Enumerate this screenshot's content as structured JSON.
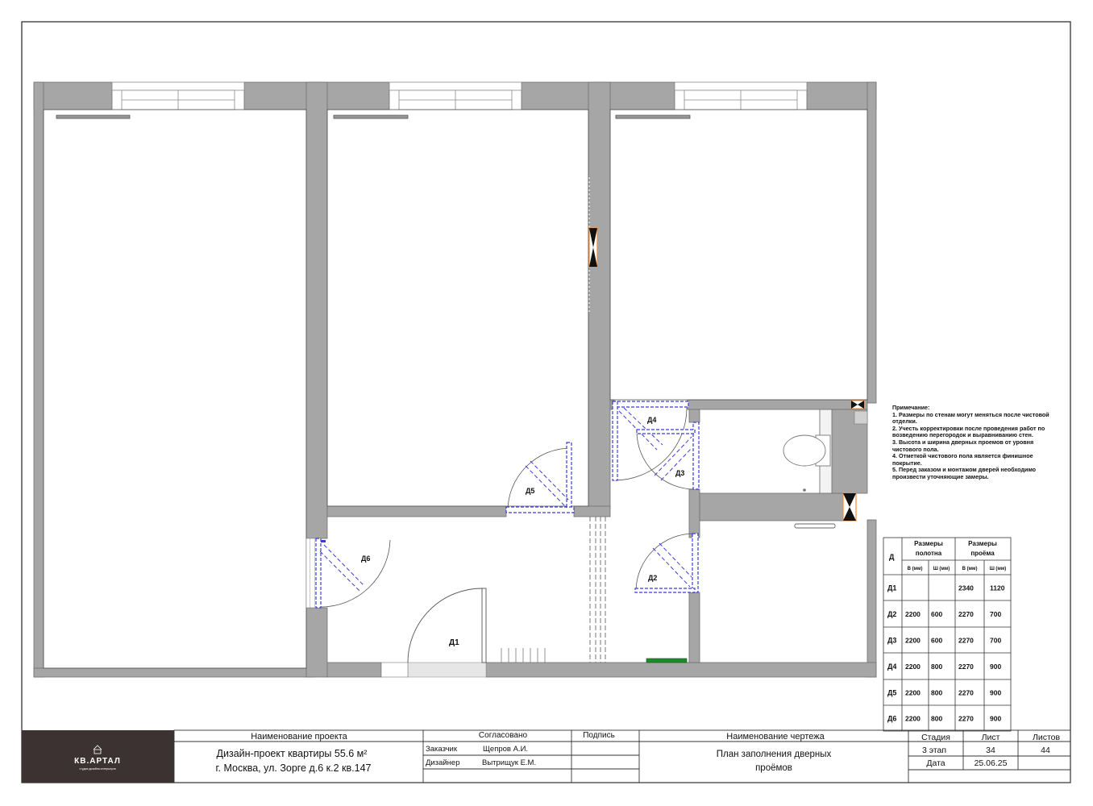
{
  "doors": [
    {
      "id": "Д1",
      "leaf_h": "",
      "leaf_w": "",
      "open_h": "2340",
      "open_w": "1120"
    },
    {
      "id": "Д2",
      "leaf_h": "2200",
      "leaf_w": "600",
      "open_h": "2270",
      "open_w": "700"
    },
    {
      "id": "Д3",
      "leaf_h": "2200",
      "leaf_w": "600",
      "open_h": "2270",
      "open_w": "700"
    },
    {
      "id": "Д4",
      "leaf_h": "2200",
      "leaf_w": "800",
      "open_h": "2270",
      "open_w": "900"
    },
    {
      "id": "Д5",
      "leaf_h": "2200",
      "leaf_w": "800",
      "open_h": "2270",
      "open_w": "900"
    },
    {
      "id": "Д6",
      "leaf_h": "2200",
      "leaf_w": "800",
      "open_h": "2270",
      "open_w": "900"
    }
  ],
  "table_head": {
    "col_d": "Д",
    "leaf_group": [
      "Размеры",
      "полотна"
    ],
    "open_group": [
      "Размеры",
      "проёма"
    ],
    "h_mm": "В (мм)",
    "w_mm": "Ш (мм)"
  },
  "notes": {
    "title": "Примечание:",
    "lines": [
      "1. Размеры по стенам могут меняться после чистовой отделки.",
      "2. Учесть корректировки после проведения работ по возведению перегородок и выравниванию стен.",
      "3. Высота и ширина дверных проемов от уровня чистового пола.",
      "4. Отметкой чистового пола является финишное покрытие.",
      "5. Перед заказом и монтажом дверей необходимо произвести уточняющие замеры."
    ]
  },
  "title_block": {
    "logo_text": "КВ.АРТАЛ",
    "logo_sub": "студия дизайна интерьеров",
    "project_name_label": "Наименование проекта",
    "project_line1": "Дизайн-проект квартиры 55.6 м²",
    "project_line2": "г. Москва, ул. Зорге д.6 к.2 кв.147",
    "agreed_label": "Согласовано",
    "signature_label": "Подпись",
    "customer_role": "Заказчик",
    "customer_name": "Щепров А.И.",
    "designer_role": "Дизайнер",
    "designer_name": "Вытрищук Е.М.",
    "drawing_name_label": "Наименование чертежа",
    "drawing_line1": "План заполнения дверных",
    "drawing_line2": "проёмов",
    "stage_label": "Стадия",
    "stage_value": "3 этап",
    "sheet_label": "Лист",
    "sheet_value": "34",
    "sheets_label": "Листов",
    "sheets_value": "44",
    "date_label": "Дата",
    "date_value": "25.06.25"
  },
  "colors": {
    "wall": "#a6a6a6",
    "wall_edge": "#6f6f6f",
    "door_leaf": "#3b3bd6",
    "frame_orange": "#f08a3c",
    "radiator_green": "#1f8a2c",
    "logo_bg": "#3c3232"
  }
}
